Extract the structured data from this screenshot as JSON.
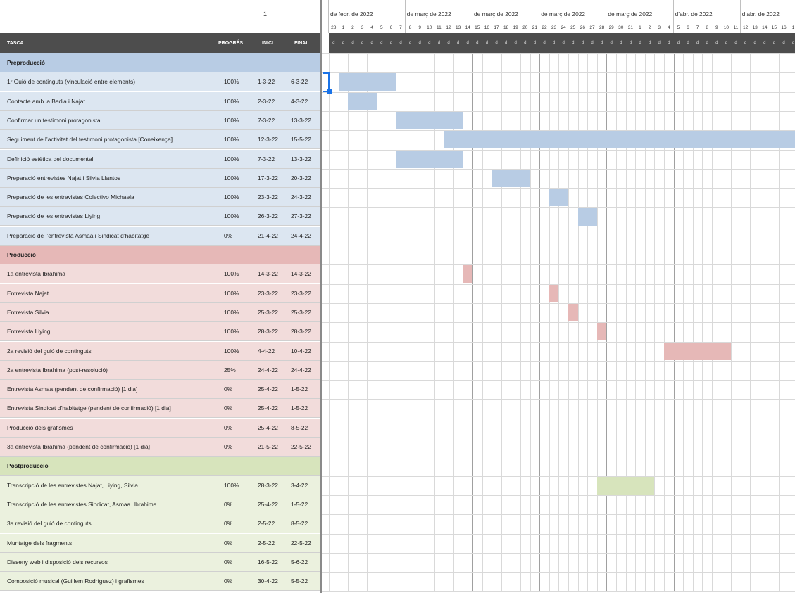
{
  "header": {
    "week_number": "1",
    "columns": {
      "task": "TASCA",
      "progress": "PROGRÉS",
      "start": "INICI",
      "end": "FINAL"
    },
    "months": [
      "de febr. de 2022",
      "de març de 2022",
      "de març de 2022",
      "de març de 2022",
      "de març de 2022",
      "d’abr. de 2022",
      "d’abr. de 2022"
    ],
    "day_numbers": [
      "28",
      "1",
      "2",
      "3",
      "4",
      "5",
      "6",
      "7",
      "8",
      "9",
      "10",
      "11",
      "12",
      "13",
      "14",
      "15",
      "16",
      "17",
      "18",
      "19",
      "20",
      "21",
      "22",
      "23",
      "24",
      "25",
      "26",
      "27",
      "28",
      "29",
      "30",
      "31",
      "1",
      "2",
      "3",
      "4",
      "5",
      "6",
      "7",
      "8",
      "9",
      "10",
      "11",
      "12",
      "13",
      "14",
      "15",
      "16",
      "1"
    ],
    "day_letter": "d"
  },
  "colors": {
    "preproduccio_phase": "#b8cce4",
    "preproduccio_row": "#dce6f1",
    "preproduccio_bar": "#b8cce4",
    "produccio_phase": "#e6b8b7",
    "produccio_row": "#f2dcdb",
    "produccio_bar": "#e6b8b7",
    "postproduccio_phase": "#d7e4bc",
    "postproduccio_row": "#ebf1de",
    "postproduccio_bar": "#d7e4bc",
    "header_bg": "#4d4d4d"
  },
  "rows": [
    {
      "type": "phase",
      "group": "pre",
      "task": "Preproducció",
      "progress": "",
      "start": "",
      "end": ""
    },
    {
      "type": "task",
      "group": "pre",
      "task": "1r Guió de continguts (vinculació entre elements)",
      "progress": "100%",
      "start": "1-3-22",
      "end": "6-3-22",
      "bar_start": 1,
      "bar_days": 6
    },
    {
      "type": "task",
      "group": "pre",
      "task": "Contacte amb la Badia i Najat",
      "progress": "100%",
      "start": "2-3-22",
      "end": "4-3-22",
      "bar_start": 2,
      "bar_days": 3
    },
    {
      "type": "task",
      "group": "pre",
      "task": "Confirmar un testimoni protagonista",
      "progress": "100%",
      "start": "7-3-22",
      "end": "13-3-22",
      "bar_start": 7,
      "bar_days": 7
    },
    {
      "type": "task",
      "group": "pre",
      "task": "Seguiment de l’activitat del testimoni protagonista [Coneixença]",
      "progress": "100%",
      "start": "12-3-22",
      "end": "15-5-22",
      "bar_start": 12,
      "bar_days": 40
    },
    {
      "type": "task",
      "group": "pre",
      "task": "Definició estètica del documental",
      "progress": "100%",
      "start": "7-3-22",
      "end": "13-3-22",
      "bar_start": 7,
      "bar_days": 7
    },
    {
      "type": "task",
      "group": "pre",
      "task": "Preparació entrevistes Najat i Silvia Llantos",
      "progress": "100%",
      "start": "17-3-22",
      "end": "20-3-22",
      "bar_start": 17,
      "bar_days": 4
    },
    {
      "type": "task",
      "group": "pre",
      "task": "Preparació de les entrevistes Colectivo Michaela",
      "progress": "100%",
      "start": "23-3-22",
      "end": "24-3-22",
      "bar_start": 23,
      "bar_days": 2
    },
    {
      "type": "task",
      "group": "pre",
      "task": "Preparació de les entrevistes Liying",
      "progress": "100%",
      "start": "26-3-22",
      "end": "27-3-22",
      "bar_start": 26,
      "bar_days": 2
    },
    {
      "type": "task",
      "group": "pre",
      "task": "Preparació de l’entrevista Asmaa i Sindicat d’habitatge",
      "progress": "0%",
      "start": "21-4-22",
      "end": "24-4-22"
    },
    {
      "type": "phase",
      "group": "pro",
      "task": "Producció",
      "progress": "",
      "start": "",
      "end": ""
    },
    {
      "type": "task",
      "group": "pro",
      "task": "1a entrevista Ibrahima",
      "progress": "100%",
      "start": "14-3-22",
      "end": "14-3-22",
      "bar_start": 14,
      "bar_days": 1
    },
    {
      "type": "task",
      "group": "pro",
      "task": "Entrevista Najat",
      "progress": "100%",
      "start": "23-3-22",
      "end": "23-3-22",
      "bar_start": 23,
      "bar_days": 1
    },
    {
      "type": "task",
      "group": "pro",
      "task": "Entrevista Silvia",
      "progress": "100%",
      "start": "25-3-22",
      "end": "25-3-22",
      "bar_start": 25,
      "bar_days": 1
    },
    {
      "type": "task",
      "group": "pro",
      "task": "Entrevista Liying",
      "progress": "100%",
      "start": "28-3-22",
      "end": "28-3-22",
      "bar_start": 28,
      "bar_days": 1
    },
    {
      "type": "task",
      "group": "pro",
      "task": "2a revisió del guió de continguts",
      "progress": "100%",
      "start": "4-4-22",
      "end": "10-4-22",
      "bar_start": 35,
      "bar_days": 7
    },
    {
      "type": "task",
      "group": "pro",
      "task": "2a entrevista Ibrahima (post-resolució)",
      "progress": "25%",
      "start": "24-4-22",
      "end": "24-4-22"
    },
    {
      "type": "task",
      "group": "pro",
      "task": "Entrevista Asmaa (pendent de confirmació) [1 dia]",
      "progress": "0%",
      "start": "25-4-22",
      "end": "1-5-22"
    },
    {
      "type": "task",
      "group": "pro",
      "task": "Entrevista Sindicat d’habitatge (pendent de confirmació) [1 dia]",
      "progress": "0%",
      "start": "25-4-22",
      "end": "1-5-22"
    },
    {
      "type": "task",
      "group": "pro",
      "task": "Producció dels grafismes",
      "progress": "0%",
      "start": "25-4-22",
      "end": "8-5-22"
    },
    {
      "type": "task",
      "group": "pro",
      "task": "3a entrevista Ibrahima (pendent de confirmacio) [1 dia]",
      "progress": "0%",
      "start": "21-5-22",
      "end": "22-5-22"
    },
    {
      "type": "phase",
      "group": "post",
      "task": "Postproducció",
      "progress": "",
      "start": "",
      "end": ""
    },
    {
      "type": "task",
      "group": "post",
      "task": "Transcripció de les entrevistes Najat, Liying, Silvia",
      "progress": "100%",
      "start": "28-3-22",
      "end": "3-4-22",
      "bar_start": 28,
      "bar_days": 6
    },
    {
      "type": "task",
      "group": "post",
      "task": "Transcripció de les entrevistes Sindicat, Asmaa. Ibrahima",
      "progress": "0%",
      "start": "25-4-22",
      "end": "1-5-22"
    },
    {
      "type": "task",
      "group": "post",
      "task": "3a revisió del guió de continguts",
      "progress": "0%",
      "start": "2-5-22",
      "end": "8-5-22"
    },
    {
      "type": "task",
      "group": "post",
      "task": "Muntatge dels fragments",
      "progress": "0%",
      "start": "2-5-22",
      "end": "22-5-22"
    },
    {
      "type": "task",
      "group": "post",
      "task": "Disseny web i disposició dels recursos",
      "progress": "0%",
      "start": "16-5-22",
      "end": "5-6-22"
    },
    {
      "type": "task",
      "group": "post",
      "task": "Composició musical (Guillem Rodríguez) i grafismes",
      "progress": "0%",
      "start": "30-4-22",
      "end": "5-5-22"
    }
  ]
}
